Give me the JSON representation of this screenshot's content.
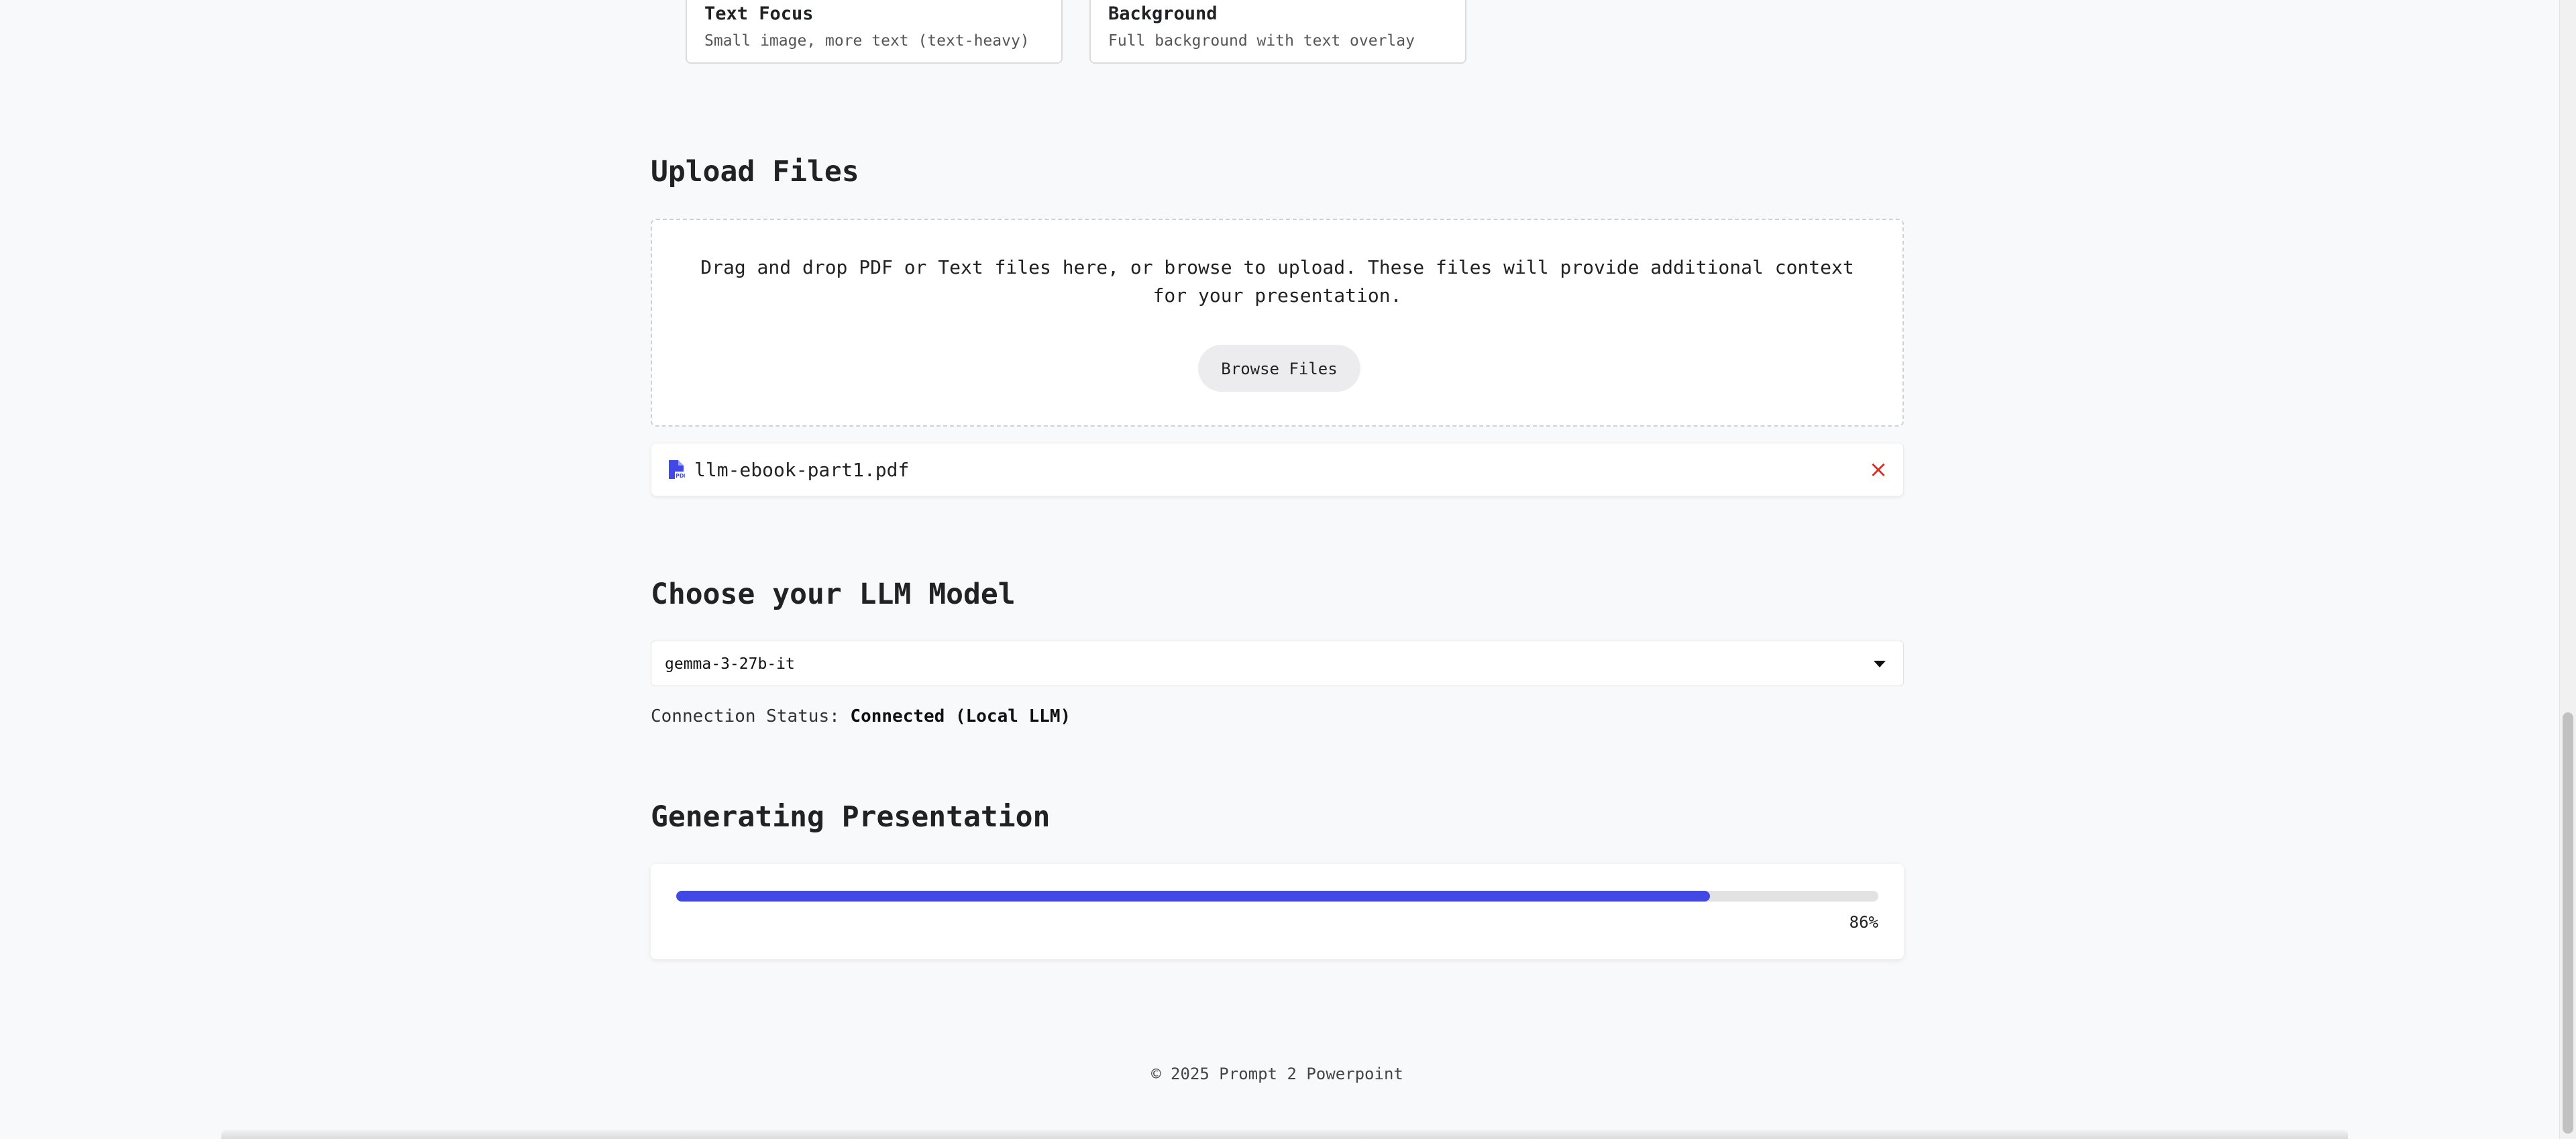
{
  "layout_options": [
    {
      "title": "Text Focus",
      "description": "Small image, more text (text-heavy)"
    },
    {
      "title": "Background",
      "description": "Full background with text overlay"
    }
  ],
  "upload": {
    "heading": "Upload Files",
    "dropzone_text": "Drag and drop PDF or Text files here, or browse to upload. These files will provide additional context for your presentation.",
    "browse_label": "Browse Files",
    "files": [
      {
        "name": "llm-ebook-part1.pdf",
        "icon": "pdf-file-icon",
        "remove_icon": "close-icon",
        "remove_symbol": "×"
      }
    ]
  },
  "model": {
    "heading": "Choose your LLM Model",
    "selected": "gemma-3-27b-it",
    "status_label": "Connection Status:",
    "status_value": "Connected (Local LLM)"
  },
  "generation": {
    "heading": "Generating Presentation",
    "progress_percent": 86,
    "progress_label": "86%"
  },
  "footer": {
    "text": "© 2025 Prompt 2 Powerpoint"
  },
  "colors": {
    "accent": "#4148e6",
    "remove": "#d93025",
    "background": "#f8f9fa"
  }
}
